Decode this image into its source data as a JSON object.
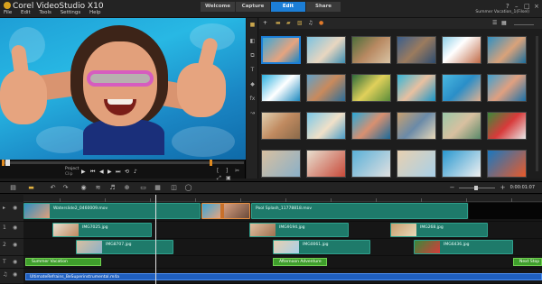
{
  "app": {
    "title": "Corel VideoStudio X10",
    "project_name": "Summer Vacation_1(Filsel)"
  },
  "menu": [
    "File",
    "Edit",
    "Tools",
    "Settings",
    "Help"
  ],
  "step_tabs": [
    {
      "label": "Welcome",
      "active": false
    },
    {
      "label": "Capture",
      "active": false
    },
    {
      "label": "Edit",
      "active": true
    },
    {
      "label": "Share",
      "active": false
    }
  ],
  "player": {
    "project_label": "Project",
    "clip_label": "Clip"
  },
  "timeline": {
    "timecode": "0:00:01:07",
    "video_track": [
      {
        "label": "Waterslide2_0460009.mov"
      },
      {
        "label": "Pool Splash_11778818.mov"
      }
    ],
    "overlay1": [
      {
        "label": "IMG7025.jpg"
      },
      {
        "label": "IMG9194.jpg"
      },
      {
        "label": "IMG268.jpg"
      }
    ],
    "overlay2": [
      {
        "label": "IMG8707.jpg"
      },
      {
        "label": "IMG0061.jpg"
      },
      {
        "label": "IMG6436.jpg"
      }
    ],
    "titles": [
      {
        "label": "Summer Vacation"
      },
      {
        "label": "Afternoon Adventure"
      },
      {
        "label": "Next Stop"
      }
    ],
    "music": {
      "label": "UltimateRefrains_BeSuperinstrumental.m4a"
    }
  },
  "colors": {
    "accent": "#1c7ed6",
    "video_clip": "#1e7a6a",
    "title_clip": "#3f9e2c",
    "audio_clip": "#1f5fbf"
  }
}
